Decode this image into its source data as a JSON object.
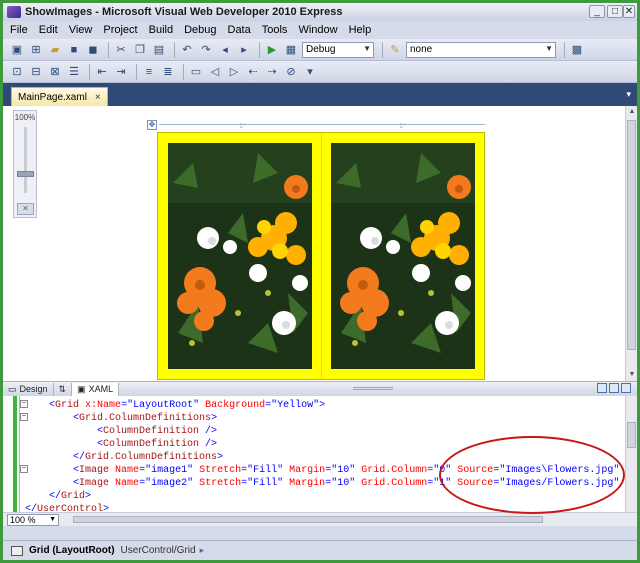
{
  "window": {
    "title": "ShowImages - Microsoft Visual Web Developer 2010 Express",
    "controls": [
      "_",
      "□",
      "✕"
    ]
  },
  "menu": [
    "File",
    "Edit",
    "View",
    "Project",
    "Build",
    "Debug",
    "Data",
    "Tools",
    "Window",
    "Help"
  ],
  "toolbar": {
    "configuration": "Debug",
    "platform": "none"
  },
  "document_tab": {
    "label": "MainPage.xaml",
    "close": "×",
    "dropdown": "▾"
  },
  "designer": {
    "zoom_label": "100%",
    "ruler_marks": [
      "1*",
      "1*"
    ],
    "grid_background": "#ffff00"
  },
  "view_tabs": {
    "design": "Design",
    "swap": "⇅",
    "xaml": "XAML"
  },
  "code_lines": [
    {
      "indent": "    ",
      "parts": [
        [
          "pun",
          "<"
        ],
        [
          "tag",
          "Grid"
        ],
        [
          "attr",
          " x:Name"
        ],
        [
          "pun",
          "=\""
        ],
        [
          "val",
          "LayoutRoot"
        ],
        [
          "pun",
          "\""
        ],
        [
          "attr",
          " Background"
        ],
        [
          "pun",
          "=\""
        ],
        [
          "val",
          "Yellow"
        ],
        [
          "pun",
          "\">"
        ]
      ]
    },
    {
      "indent": "        ",
      "parts": [
        [
          "pun",
          "<"
        ],
        [
          "tag",
          "Grid.ColumnDefinitions"
        ],
        [
          "pun",
          ">"
        ]
      ]
    },
    {
      "indent": "            ",
      "parts": [
        [
          "pun",
          "<"
        ],
        [
          "tag",
          "ColumnDefinition"
        ],
        [
          "pun",
          " />"
        ]
      ]
    },
    {
      "indent": "            ",
      "parts": [
        [
          "pun",
          "<"
        ],
        [
          "tag",
          "ColumnDefinition"
        ],
        [
          "pun",
          " />"
        ]
      ]
    },
    {
      "indent": "        ",
      "parts": [
        [
          "pun",
          "</"
        ],
        [
          "tag",
          "Grid.ColumnDefinitions"
        ],
        [
          "pun",
          ">"
        ]
      ]
    },
    {
      "indent": "        ",
      "parts": [
        [
          "pun",
          "<"
        ],
        [
          "tag",
          "Image"
        ],
        [
          "attr",
          " Name"
        ],
        [
          "pun",
          "=\""
        ],
        [
          "val",
          "image1"
        ],
        [
          "pun",
          "\""
        ],
        [
          "attr",
          " Stretch"
        ],
        [
          "pun",
          "=\""
        ],
        [
          "val",
          "Fill"
        ],
        [
          "pun",
          "\""
        ],
        [
          "attr",
          " Margin"
        ],
        [
          "pun",
          "=\""
        ],
        [
          "val",
          "10"
        ],
        [
          "pun",
          "\""
        ],
        [
          "attr",
          " Grid.Column"
        ],
        [
          "pun",
          "=\""
        ],
        [
          "val",
          "0"
        ],
        [
          "pun",
          "\""
        ],
        [
          "attr",
          " Source"
        ],
        [
          "pun",
          "=\""
        ],
        [
          "val",
          "Images\\Flowers.jpg"
        ],
        [
          "pun",
          "\" />"
        ]
      ]
    },
    {
      "indent": "        ",
      "parts": [
        [
          "pun",
          "<"
        ],
        [
          "tag",
          "Image"
        ],
        [
          "attr",
          " Name"
        ],
        [
          "pun",
          "=\""
        ],
        [
          "val",
          "image2"
        ],
        [
          "pun",
          "\""
        ],
        [
          "attr",
          " Stretch"
        ],
        [
          "pun",
          "=\""
        ],
        [
          "val",
          "Fill"
        ],
        [
          "pun",
          "\""
        ],
        [
          "attr",
          " Margin"
        ],
        [
          "pun",
          "=\""
        ],
        [
          "val",
          "10"
        ],
        [
          "pun",
          "\""
        ],
        [
          "attr",
          " Grid.Column"
        ],
        [
          "pun",
          "=\""
        ],
        [
          "val",
          "1"
        ],
        [
          "pun",
          "\""
        ],
        [
          "attr",
          " Source"
        ],
        [
          "pun",
          "=\""
        ],
        [
          "val",
          "Images/Flowers.jpg"
        ],
        [
          "pun",
          "\"  />"
        ]
      ]
    },
    {
      "indent": "    ",
      "parts": [
        [
          "pun",
          "</"
        ],
        [
          "tag",
          "Grid"
        ],
        [
          "pun",
          ">"
        ]
      ]
    },
    {
      "indent": "",
      "parts": [
        [
          "pun",
          "</"
        ],
        [
          "tag",
          "UserControl"
        ],
        [
          "pun",
          ">"
        ]
      ]
    }
  ],
  "code_zoom": "100 %",
  "status": {
    "element": "Grid (LayoutRoot)",
    "path": "UserControl/Grid",
    "arrow": "▸"
  },
  "colors": {
    "annotation": "#c41818",
    "grid_yellow": "#ffff00",
    "window_border": "#3e9a3c"
  }
}
